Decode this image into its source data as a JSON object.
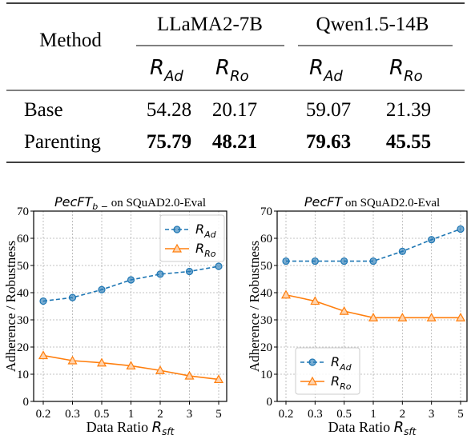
{
  "table": {
    "method_header": "Method",
    "models": [
      "LLaMA2-7B",
      "Qwen1.5-14B"
    ],
    "metric_main": "R",
    "metrics": [
      "Ad",
      "Ro",
      "Ad",
      "Ro"
    ],
    "rows": [
      {
        "name": "Base",
        "values": [
          "54.28",
          "20.17",
          "59.07",
          "21.39"
        ],
        "bold": false
      },
      {
        "name": "Parenting",
        "values": [
          "75.79",
          "48.21",
          "79.63",
          "45.55"
        ],
        "bold": true
      }
    ]
  },
  "chart_data": [
    {
      "type": "line",
      "title_italic": "PecFT",
      "title_sub": "b −",
      "title_rest": " on SQuAD2.0-Eval",
      "xlabel": "Data Ratio ",
      "xlabel_italic": "R",
      "xlabel_sub": "sft",
      "ylabel": "Adherence / Robustness",
      "categories": [
        "0.2",
        "0.3",
        "0.5",
        "1",
        "2",
        "3",
        "5"
      ],
      "ylim": [
        0,
        70
      ],
      "yticks": [
        "0",
        "10",
        "20",
        "30",
        "40",
        "50",
        "60",
        "70"
      ],
      "grid": true,
      "legend": "top-right",
      "series": [
        {
          "name": "R_Ad",
          "label": "R",
          "sub": "Ad",
          "color": "#1f77b4",
          "marker": "circle",
          "dash": true,
          "values": [
            36.9,
            38.2,
            41.1,
            44.7,
            46.8,
            47.8,
            49.7
          ]
        },
        {
          "name": "R_Ro",
          "label": "R",
          "sub": "Ro",
          "color": "#ff7f0e",
          "marker": "triangle",
          "dash": false,
          "values": [
            16.9,
            15.0,
            14.2,
            13.1,
            11.4,
            9.4,
            8.1
          ]
        }
      ]
    },
    {
      "type": "line",
      "title_italic": "PecFT",
      "title_sub": "",
      "title_rest": " on SQuAD2.0-Eval",
      "xlabel": "Data Ratio ",
      "xlabel_italic": "R",
      "xlabel_sub": "sft",
      "ylabel": "Adherence / Robustness",
      "categories": [
        "0.2",
        "0.3",
        "0.5",
        "1",
        "2",
        "3",
        "5"
      ],
      "ylim": [
        0,
        70
      ],
      "yticks": [
        "0",
        "10",
        "20",
        "30",
        "40",
        "50",
        "60",
        "70"
      ],
      "grid": true,
      "legend": "bottom-left",
      "series": [
        {
          "name": "R_Ad",
          "label": "R",
          "sub": "Ad",
          "color": "#1f77b4",
          "marker": "circle",
          "dash": true,
          "values": [
            51.6,
            51.6,
            51.6,
            51.6,
            55.2,
            59.5,
            63.4
          ]
        },
        {
          "name": "R_Ro",
          "label": "R",
          "sub": "Ro",
          "color": "#ff7f0e",
          "marker": "triangle",
          "dash": false,
          "values": [
            39.2,
            36.9,
            33.2,
            30.8,
            30.8,
            30.8,
            30.8
          ]
        }
      ]
    }
  ]
}
